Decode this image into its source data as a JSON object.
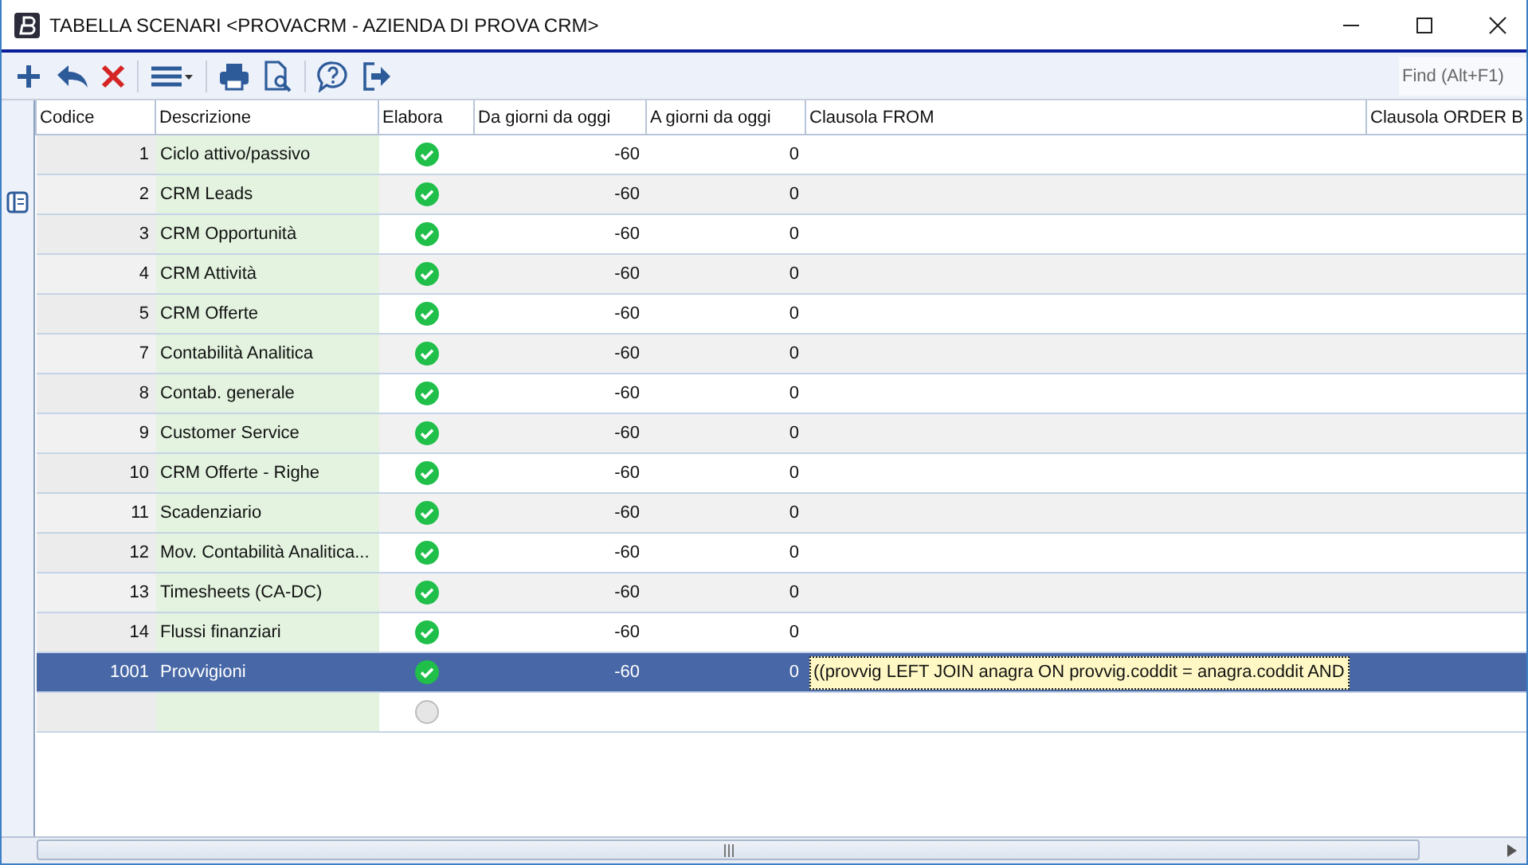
{
  "window": {
    "title": "TABELLA SCENARI <PROVACRM - AZIENDA DI PROVA CRM>"
  },
  "toolbar": {
    "find": {
      "placeholder": "Find (Alt+F1)"
    }
  },
  "table": {
    "columns": [
      "Codice",
      "Descrizione",
      "Elabora",
      "Da giorni da oggi",
      "A giorni da oggi",
      "Clausola FROM",
      "Clausola ORDER B"
    ],
    "rows": [
      {
        "codice": "1",
        "descrizione": "Ciclo attivo/passivo",
        "elabora": true,
        "da": "-60",
        "a": "0",
        "selected": false
      },
      {
        "codice": "2",
        "descrizione": "CRM Leads",
        "elabora": true,
        "da": "-60",
        "a": "0",
        "selected": false
      },
      {
        "codice": "3",
        "descrizione": "CRM Opportunità",
        "elabora": true,
        "da": "-60",
        "a": "0",
        "selected": false
      },
      {
        "codice": "4",
        "descrizione": "CRM Attività",
        "elabora": true,
        "da": "-60",
        "a": "0",
        "selected": false
      },
      {
        "codice": "5",
        "descrizione": "CRM Offerte",
        "elabora": true,
        "da": "-60",
        "a": "0",
        "selected": false
      },
      {
        "codice": "7",
        "descrizione": "Contabilità Analitica",
        "elabora": true,
        "da": "-60",
        "a": "0",
        "selected": false
      },
      {
        "codice": "8",
        "descrizione": "Contab. generale",
        "elabora": true,
        "da": "-60",
        "a": "0",
        "selected": false
      },
      {
        "codice": "9",
        "descrizione": "Customer Service",
        "elabora": true,
        "da": "-60",
        "a": "0",
        "selected": false
      },
      {
        "codice": "10",
        "descrizione": "CRM Offerte - Righe",
        "elabora": true,
        "da": "-60",
        "a": "0",
        "selected": false
      },
      {
        "codice": "11",
        "descrizione": "Scadenziario",
        "elabora": true,
        "da": "-60",
        "a": "0",
        "selected": false
      },
      {
        "codice": "12",
        "descrizione": "Mov. Contabilità Analitica...",
        "elabora": true,
        "da": "-60",
        "a": "0",
        "selected": false
      },
      {
        "codice": "13",
        "descrizione": "Timesheets (CA-DC)",
        "elabora": true,
        "da": "-60",
        "a": "0",
        "selected": false
      },
      {
        "codice": "14",
        "descrizione": "Flussi finanziari",
        "elabora": true,
        "da": "-60",
        "a": "0",
        "selected": false
      },
      {
        "codice": "1001",
        "descrizione": "Provvigioni",
        "elabora": true,
        "da": "-60",
        "a": "0",
        "from": "((provvig LEFT JOIN anagra ON provvig.coddit = anagra.coddit AND",
        "selected": true
      },
      {
        "elabora": false,
        "selected": false
      }
    ]
  }
}
